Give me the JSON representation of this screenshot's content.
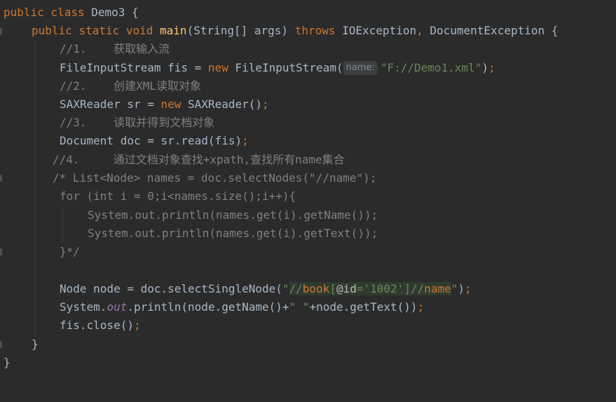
{
  "editor": {
    "lines": [
      {
        "id": "l1",
        "tokens": [
          [
            "kw",
            "public class "
          ],
          [
            "plain",
            "Demo3 {"
          ]
        ]
      },
      {
        "id": "l2",
        "tokens": [
          [
            "kw",
            "public static void "
          ],
          [
            "fn",
            "main"
          ],
          [
            "plain",
            "(String[] args) "
          ],
          [
            "kw",
            "throws "
          ],
          [
            "plain",
            "IOException"
          ],
          [
            "kw",
            ", "
          ],
          [
            "plain",
            "DocumentException {"
          ]
        ]
      },
      {
        "id": "l3",
        "tokens": [
          [
            "cm",
            "//1.    获取输入流"
          ]
        ]
      },
      {
        "id": "l4",
        "tokens": [
          [
            "plain",
            "FileInputStream fis = "
          ],
          [
            "kw",
            "new "
          ],
          [
            "plain",
            "FileInputStream("
          ],
          [
            "hint",
            "name:"
          ],
          [
            "str",
            "\"F://Demo1.xml\""
          ],
          [
            "plain",
            ")"
          ],
          [
            "kw",
            ";"
          ]
        ]
      },
      {
        "id": "l5",
        "tokens": [
          [
            "cm",
            "//2.    创建XML读取对象"
          ]
        ]
      },
      {
        "id": "l6",
        "tokens": [
          [
            "plain",
            "SAXReader sr = "
          ],
          [
            "kw",
            "new "
          ],
          [
            "plain",
            "SAXReader()"
          ],
          [
            "kw",
            ";"
          ]
        ]
      },
      {
        "id": "l7",
        "tokens": [
          [
            "cm",
            "//3.    读取并得到文档对象"
          ]
        ]
      },
      {
        "id": "l8",
        "tokens": [
          [
            "plain",
            "Document doc = sr.read(fis)"
          ],
          [
            "kw",
            ";"
          ]
        ]
      },
      {
        "id": "l9",
        "tokens": [
          [
            "cm",
            "//4.     通过文档对象查找+xpath,查找所有name集合"
          ]
        ]
      },
      {
        "id": "l10",
        "tokens": [
          [
            "cm",
            "/* List<Node> names = doc.selectNodes(\"//name\");"
          ]
        ]
      },
      {
        "id": "l11",
        "tokens": [
          [
            "cm",
            "for (int i = 0;i<names.size();i++){"
          ]
        ]
      },
      {
        "id": "l12",
        "tokens": [
          [
            "cm",
            "System.out.println(names.get(i).getName());"
          ]
        ]
      },
      {
        "id": "l13",
        "tokens": [
          [
            "cm",
            "System.out.println(names.get(i).getText());"
          ]
        ]
      },
      {
        "id": "l14",
        "tokens": [
          [
            "cm",
            "}*/"
          ]
        ]
      },
      {
        "id": "l15",
        "tokens": []
      },
      {
        "id": "l16",
        "tokens": [
          [
            "plain",
            "Node node = doc.selectSingleNode("
          ],
          [
            "str",
            "\""
          ],
          [
            "xp",
            "//"
          ],
          [
            "xptag",
            "book"
          ],
          [
            "xp",
            "["
          ],
          [
            "xpattr",
            "@id"
          ],
          [
            "xp",
            "="
          ],
          [
            "xpstr",
            "'1002'"
          ],
          [
            "xp",
            "]//"
          ],
          [
            "xptag",
            "name"
          ],
          [
            "str",
            "\""
          ],
          [
            "plain",
            ")"
          ],
          [
            "kw",
            ";"
          ]
        ]
      },
      {
        "id": "l17",
        "tokens": [
          [
            "plain",
            "System."
          ],
          [
            "fld",
            "out"
          ],
          [
            "plain",
            ".println(node.getName()+"
          ],
          [
            "str",
            "\" \""
          ],
          [
            "plain",
            "+node.getText())"
          ],
          [
            "kw",
            ";"
          ]
        ]
      },
      {
        "id": "l18",
        "tokens": [
          [
            "plain",
            "fis.close()"
          ],
          [
            "kw",
            ";"
          ]
        ]
      },
      {
        "id": "l19",
        "tokens": [
          [
            "plain",
            "}"
          ]
        ]
      },
      {
        "id": "l20",
        "tokens": [
          [
            "plain",
            "}"
          ]
        ]
      }
    ]
  }
}
